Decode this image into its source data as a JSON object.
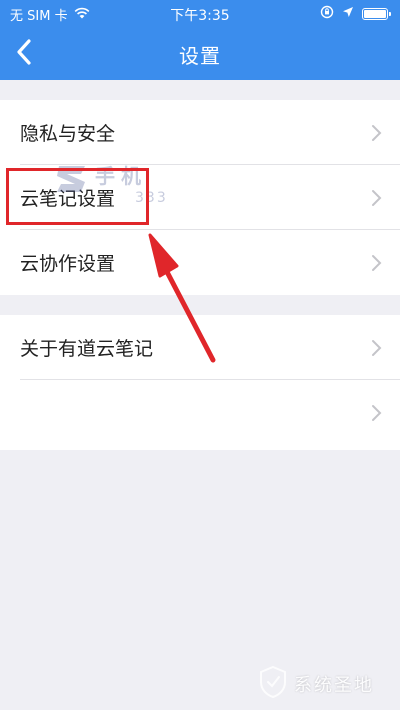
{
  "status_bar": {
    "carrier": "无 SIM 卡",
    "time": "下午3:35",
    "icons": [
      "wifi-icon",
      "rotation-lock-icon",
      "location-arrow-icon",
      "battery-icon"
    ]
  },
  "nav_bar": {
    "title": "设置",
    "back_icon": "chevron-left-icon"
  },
  "groups": [
    {
      "items": [
        {
          "label": "隐私与安全"
        },
        {
          "label": "云笔记设置",
          "highlighted": true
        },
        {
          "label": "云协作设置"
        }
      ]
    },
    {
      "items": [
        {
          "label": "关于有道云笔记"
        },
        {
          "label": ""
        }
      ]
    }
  ],
  "watermarks": {
    "center": "手机",
    "center_sub": "333",
    "corner": "系统圣地"
  },
  "colors": {
    "header_blue": "#3b8ded",
    "background": "#efeff4",
    "highlight_red": "#e0262a"
  }
}
